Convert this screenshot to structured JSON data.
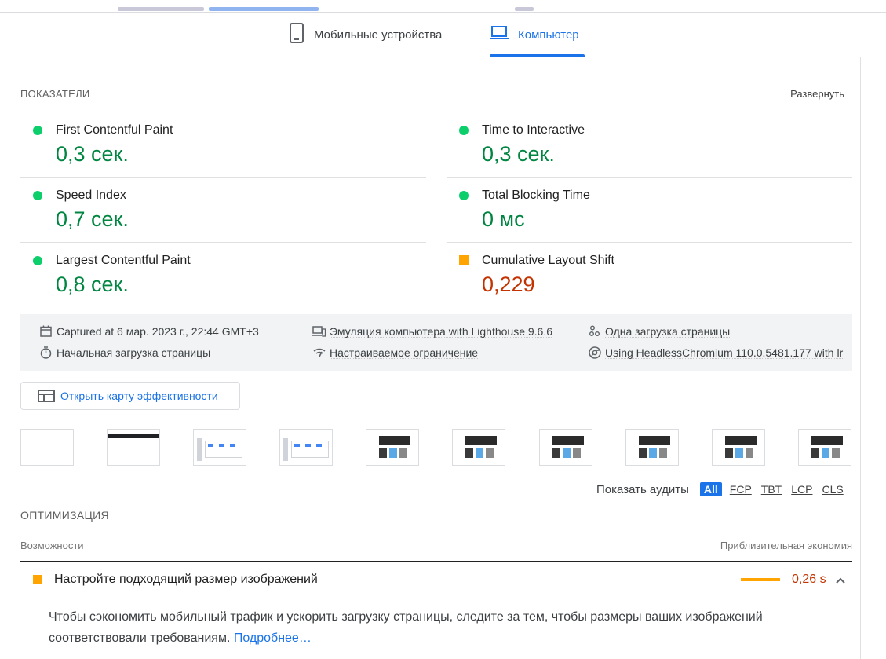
{
  "tabs": {
    "mobile": "Мобильные устройства",
    "desktop": "Компьютер"
  },
  "metrics": {
    "heading": "ПОКАЗАТЕЛИ",
    "expand": "Развернуть",
    "fcp": {
      "label": "First Contentful Paint",
      "value": "0,3 сек.",
      "status": "good"
    },
    "tti": {
      "label": "Time to Interactive",
      "value": "0,3 сек.",
      "status": "good"
    },
    "si": {
      "label": "Speed Index",
      "value": "0,7 сек.",
      "status": "good"
    },
    "tbt": {
      "label": "Total Blocking Time",
      "value": "0 мс",
      "status": "good"
    },
    "lcp": {
      "label": "Largest Contentful Paint",
      "value": "0,8 сек.",
      "status": "good"
    },
    "cls": {
      "label": "Cumulative Layout Shift",
      "value": "0,229",
      "status": "average"
    }
  },
  "runtime": {
    "captured": "Captured at 6 мар. 2023 г., 22:44 GMT+3",
    "emulation": "Эмуляция компьютера with Lighthouse 9.6.6",
    "single_load": "Одна загрузка страницы",
    "initial_load": "Начальная загрузка страницы",
    "throttling": "Настраиваемое ограничение",
    "browser": "Using HeadlessChromium 110.0.5481.177 with lr"
  },
  "treemap_button": "Открыть карту эффективности",
  "filmstrip_frames": 10,
  "audit_filter": {
    "label": "Показать аудиты",
    "chips": [
      "All",
      "FCP",
      "TBT",
      "LCP",
      "CLS"
    ],
    "selected": "All"
  },
  "opportunities": {
    "heading": "ОПТИМИЗАЦИЯ",
    "col_left": "Возможности",
    "col_right": "Приблизительная экономия",
    "item": {
      "title": "Настройте подходящий размер изображений",
      "saving": "0,26 s",
      "description": "Чтобы сэкономить мобильный трафик и ускорить загрузку страницы, следите за тем, чтобы размеры ваших изображений соответствовали требованиям.",
      "learn_more": "Подробнее…"
    }
  },
  "colors": {
    "accent": "#1a73e8",
    "good": "#018642",
    "good_dot": "#0cce6b",
    "average": "#c33300",
    "average_marker": "#ffa400"
  }
}
